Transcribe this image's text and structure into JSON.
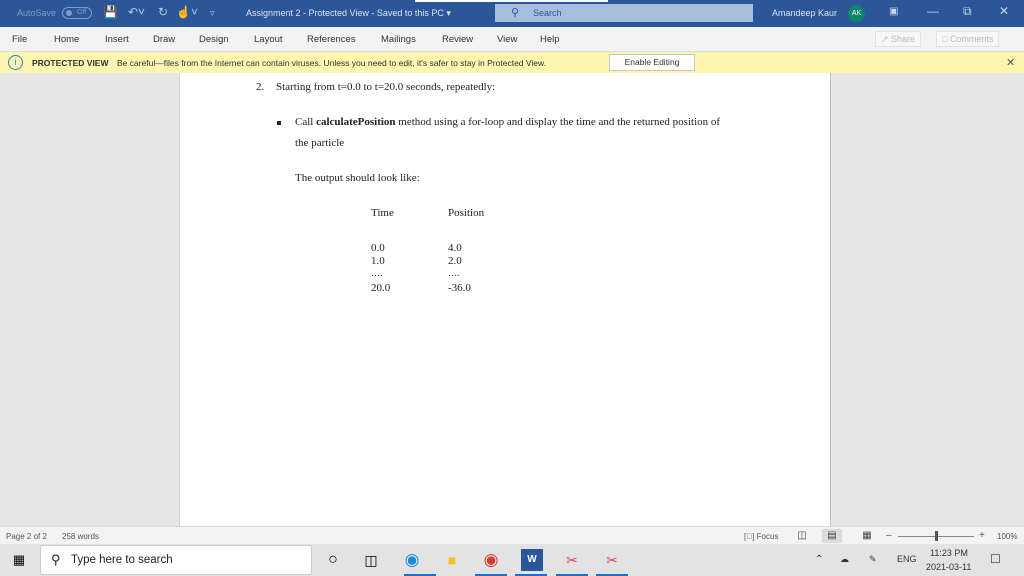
{
  "titlebar": {
    "autosave_label": "AutoSave",
    "autosave_state": "Off",
    "doc_title": "Assignment 2  -  Protected View  -  Saved to this PC ▾",
    "search_placeholder": "Search",
    "user_name": "Amandeep Kaur",
    "user_initials": "AK"
  },
  "ribbon": {
    "tabs": [
      "File",
      "Home",
      "Insert",
      "Draw",
      "Design",
      "Layout",
      "References",
      "Mailings",
      "Review",
      "View",
      "Help"
    ],
    "share_label": "Share",
    "comments_label": "Comments"
  },
  "protected_view": {
    "label": "PROTECTED VIEW",
    "message": "Be careful—files from the Internet can contain viruses. Unless you need to edit, it's safer to stay in Protected View.",
    "enable_button": "Enable Editing"
  },
  "document": {
    "item_number": "2.",
    "item_text": "Starting from t=0.0 to t=20.0 seconds, repeatedly:",
    "bullet_prefix": "Call ",
    "bullet_bold": "calculatePosition",
    "bullet_rest": " method using a for-loop and display the time and the returned position of",
    "bullet_line2": "the particle",
    "output_intro": "The output should look like:",
    "table": {
      "headers": [
        "Time",
        "Position"
      ],
      "rows": [
        [
          "0.0",
          "4.0"
        ],
        [
          "1.0",
          "2.0"
        ],
        [
          "….",
          "…."
        ],
        [
          "20.0",
          "-36.0"
        ]
      ]
    }
  },
  "statusbar": {
    "page": "Page 2 of 2",
    "words": "258 words",
    "focus": "Focus",
    "zoom": "100%",
    "zoom_percent": 100
  },
  "taskbar": {
    "search_placeholder": "Type here to search",
    "language": "ENG",
    "time": "11:23 PM",
    "date": "2021-03-11"
  }
}
